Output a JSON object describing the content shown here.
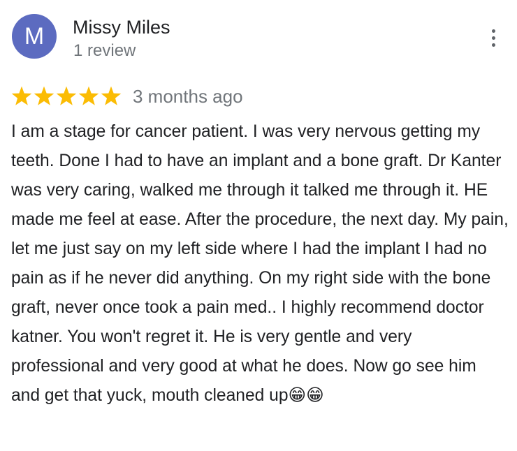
{
  "review": {
    "author": {
      "initial": "M",
      "name": "Missy Miles",
      "review_count": "1 review",
      "avatar_color": "#5c6bc0"
    },
    "more_icon": "more-vert-icon",
    "rating": 5,
    "max_rating": 5,
    "star_color": "#fbbc04",
    "date": "3 months ago",
    "text": "I am a stage for cancer patient. I was very nervous getting my teeth. Done I had to have an implant and a bone graft. Dr Kanter was very caring, walked me through it talked me through it. HE made me feel at ease. After the procedure, the next day. My pain, let me just say on my left side where I had the implant I had no pain as if he never did anything. On my right side with the bone graft, never once took a pain med.. I highly recommend doctor katner. You won't regret it. He is very gentle and very professional and very good at what he does. Now go see him and get that yuck, mouth cleaned up😁😁"
  }
}
